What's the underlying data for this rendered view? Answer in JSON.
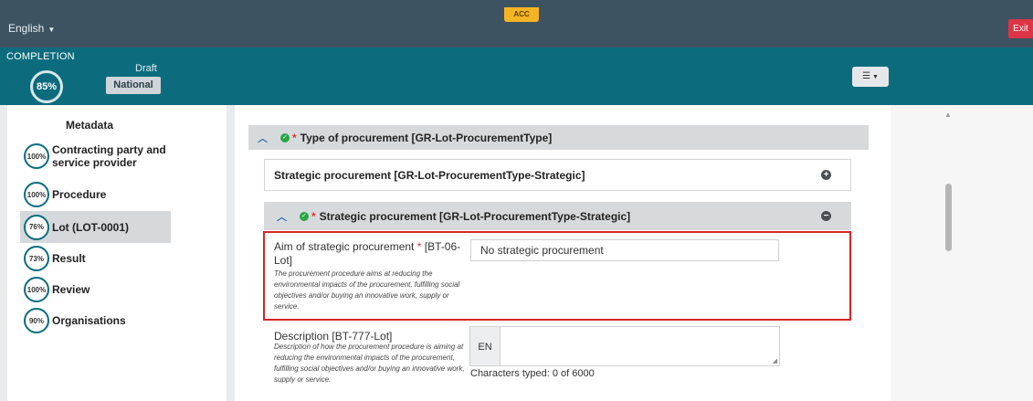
{
  "topbar": {
    "language": "English",
    "environment": "ACC",
    "exit_label": "Exit"
  },
  "header": {
    "completion_label": "COMPLETION",
    "completion_percent": "85%",
    "status": "Draft",
    "scope_badge": "National",
    "settings_icon": "sliders-icon"
  },
  "sidebar": {
    "title": "Metadata",
    "items": [
      {
        "percent": "100%",
        "label": "Contracting party and service provider"
      },
      {
        "percent": "100%",
        "label": "Procedure"
      },
      {
        "percent": "76%",
        "label": "Lot (LOT-0001)"
      },
      {
        "percent": "73%",
        "label": "Result"
      },
      {
        "percent": "100%",
        "label": "Review"
      },
      {
        "percent": "90%",
        "label": "Organisations"
      }
    ]
  },
  "main": {
    "section_title": "Type of procurement  [GR-Lot-ProcurementType]",
    "card_title": "Strategic procurement  [GR-Lot-ProcurementType-Strategic]",
    "subsection_title": "Strategic procurement  [GR-Lot-ProcurementType-Strategic]",
    "aim_field": {
      "label": "Aim of strategic procurement",
      "code": "[BT-06-Lot]",
      "help": "The procurement procedure aims at reducing the environmental impacts of the procurement, fulfilling social objectives and/or buying an innovative work, supply or service.",
      "value": "No strategic procurement"
    },
    "description_field": {
      "label": "Description [BT-777-Lot]",
      "help": "Description of how the procurement procedure is aiming at reducing the environmental impacts of the procurement, fulfilling social objectives and/or buying an innovative work, supply or service.",
      "language": "EN",
      "value": "",
      "char_count": "Characters typed: 0 of 6000"
    }
  },
  "colors": {
    "topbar": "#3d5361",
    "header": "#0c6c7e",
    "exit": "#dc3545",
    "env_badge": "#f5b423",
    "highlight": "#d92424"
  }
}
